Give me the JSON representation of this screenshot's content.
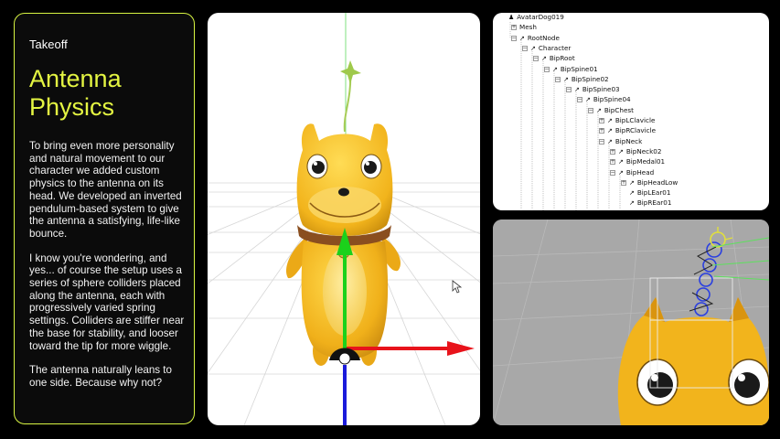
{
  "card": {
    "eyebrow": "Takeoff",
    "title": "Antenna Physics",
    "paragraphs": [
      "To bring even more personality and natural movement to our character we added custom physics to the antenna on its head. We developed an inverted pendulum-based system to give the antenna a satisfying, life-like bounce.",
      "I know you're wondering, and yes... of course the setup uses a series of sphere colliders placed along the antenna, each with progressively varied spring settings. Colliders are stiffer near the base for stability, and looser toward the tip for more wiggle.",
      "The antenna naturally leans to one side. Because why not?"
    ],
    "accent_color": "#e4f542"
  },
  "hierarchy": {
    "nodes": [
      {
        "label": "AvatarDog019",
        "depth": 0,
        "icon": "user-icon",
        "expander": "none"
      },
      {
        "label": "Mesh",
        "depth": 1,
        "icon": "none",
        "expander": "plus"
      },
      {
        "label": "RootNode",
        "depth": 1,
        "icon": "bone-icon",
        "expander": "minus"
      },
      {
        "label": "Character",
        "depth": 2,
        "icon": "bone-icon",
        "expander": "minus"
      },
      {
        "label": "BipRoot",
        "depth": 3,
        "icon": "bone-icon",
        "expander": "minus"
      },
      {
        "label": "BipSpine01",
        "depth": 4,
        "icon": "bone-icon",
        "expander": "minus"
      },
      {
        "label": "BipSpine02",
        "depth": 5,
        "icon": "bone-icon",
        "expander": "minus"
      },
      {
        "label": "BipSpine03",
        "depth": 6,
        "icon": "bone-icon",
        "expander": "minus"
      },
      {
        "label": "BipSpine04",
        "depth": 7,
        "icon": "bone-icon",
        "expander": "minus"
      },
      {
        "label": "BipChest",
        "depth": 8,
        "icon": "bone-icon",
        "expander": "minus"
      },
      {
        "label": "BipLClavicle",
        "depth": 9,
        "icon": "bone-icon",
        "expander": "plus"
      },
      {
        "label": "BipRClavicle",
        "depth": 9,
        "icon": "bone-icon",
        "expander": "plus"
      },
      {
        "label": "BipNeck",
        "depth": 9,
        "icon": "bone-icon",
        "expander": "minus"
      },
      {
        "label": "BipNeck02",
        "depth": 10,
        "icon": "bone-icon",
        "expander": "plus"
      },
      {
        "label": "BipMedal01",
        "depth": 10,
        "icon": "bone-icon",
        "expander": "plus"
      },
      {
        "label": "BipHead",
        "depth": 10,
        "icon": "bone-icon",
        "expander": "minus"
      },
      {
        "label": "BipHeadLow",
        "depth": 11,
        "icon": "bone-icon",
        "expander": "plus"
      },
      {
        "label": "BipLEar01",
        "depth": 11,
        "icon": "bone-icon",
        "expander": "none"
      },
      {
        "label": "BipREar01",
        "depth": 11,
        "icon": "bone-icon",
        "expander": "none"
      }
    ]
  },
  "colors": {
    "gizmo_x": "#e8131b",
    "gizmo_y": "#1bd11b",
    "gizmo_z": "#1a1adb",
    "dog_body": "#f2b81c",
    "collar": "#8a4e1f",
    "antenna_collider": "#2a3fe0"
  }
}
